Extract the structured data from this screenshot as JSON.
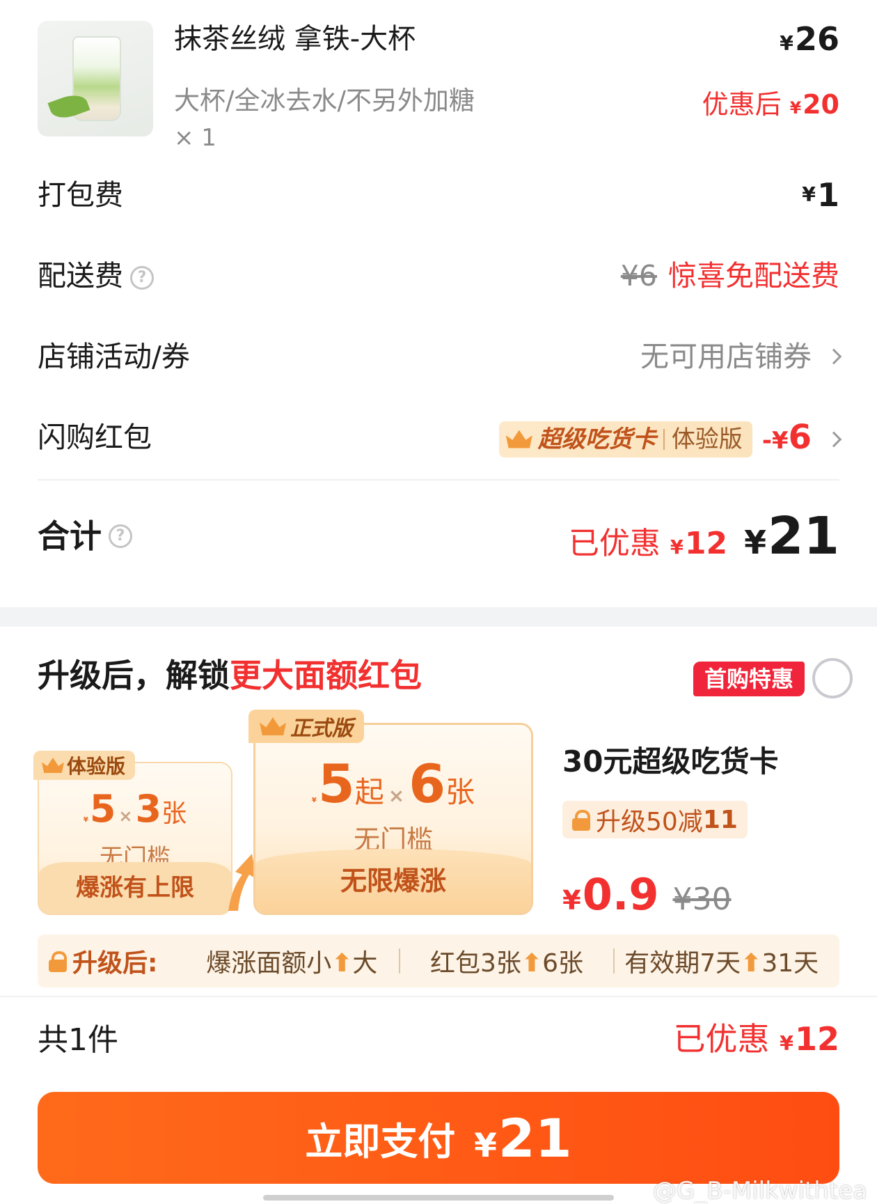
{
  "product": {
    "name": "抹茶丝绒 拿铁-大杯",
    "spec": "大杯/全冰去水/不另外加糖",
    "qty": "× 1",
    "currency": "¥",
    "price": "26",
    "after_label": "优惠后",
    "after_price": "20"
  },
  "fees": {
    "packing": {
      "label": "打包费",
      "value": "1"
    },
    "delivery": {
      "label": "配送费",
      "original": "¥6",
      "free_text": "惊喜免配送费"
    },
    "store_promo": {
      "label": "店铺活动/券",
      "value": "无可用店铺券"
    },
    "flash_redpack": {
      "label": "闪购红包",
      "badge_name": "超级吃货卡",
      "badge_tag": "体验版",
      "discount_prefix": "-¥",
      "discount": "6"
    }
  },
  "total": {
    "label": "合计",
    "saved_label": "已优惠",
    "saved": "12",
    "amount": "21"
  },
  "upgrade": {
    "title_prefix": "升级后，解锁",
    "title_highlight": "更大面额红包",
    "first_tag": "首购特惠",
    "trial_card": {
      "tag": "体验版",
      "amount": "5",
      "times": "×",
      "count": "3",
      "count_unit": "张",
      "threshold": "无门槛",
      "footer": "爆涨有上限"
    },
    "full_card": {
      "tag": "正式版",
      "amount": "5",
      "amount_unit": "起",
      "times": "×",
      "count": "6",
      "count_unit": "张",
      "threshold": "无门槛",
      "footer": "无限爆涨"
    },
    "product_name": "30元超级吃货卡",
    "deal_prefix": "升级50减",
    "deal_value": "11",
    "price_now": "0.9",
    "price_old": "¥30"
  },
  "benefits": {
    "head": "升级后:",
    "items": [
      {
        "from": "爆涨面额小",
        "to": "大"
      },
      {
        "from": "红包3张",
        "to": "6张"
      },
      {
        "from": "有效期7天",
        "to": "31天"
      }
    ]
  },
  "footer": {
    "count_text": "共1件",
    "saved_label": "已优惠",
    "saved": "12",
    "pay_label": "立即支付",
    "pay_amount": "21"
  },
  "watermark": "@G_B-Milkwithtea",
  "colors": {
    "accent_red": "#f23030",
    "pay_orange": "#ff5a14",
    "gold": "#f29a3b"
  }
}
